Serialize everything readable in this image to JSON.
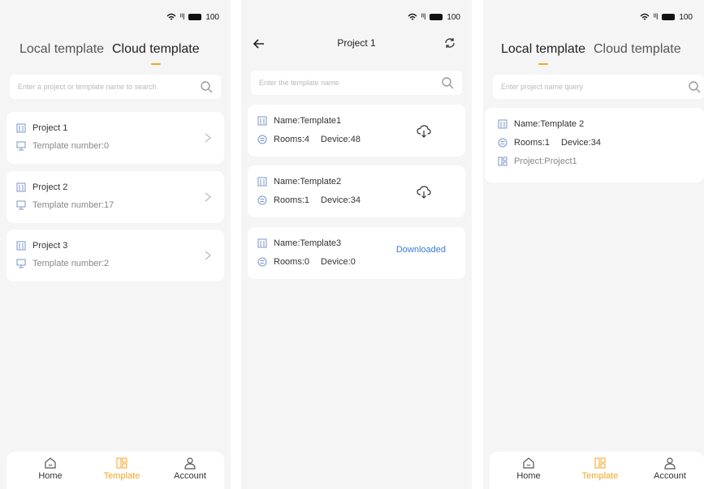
{
  "status": {
    "signal": "ᴵᴵl",
    "battery": "100"
  },
  "screen1": {
    "tabs": [
      "Local template",
      "Cloud template"
    ],
    "search_placeholder": "Enter a project or template name to search",
    "projects": [
      {
        "name": "Project 1",
        "count": "Template number:0"
      },
      {
        "name": "Project 2",
        "count": "Template number:17"
      },
      {
        "name": "Project 3",
        "count": "Template number:2"
      }
    ]
  },
  "screen2": {
    "title": "Project 1",
    "search_placeholder": "Enter the template name",
    "templates": [
      {
        "name": "Name:Template1",
        "rooms": "Rooms:4",
        "device": "Device:48",
        "state": "cloud"
      },
      {
        "name": "Name:Template2",
        "rooms": "Rooms:1",
        "device": "Device:34",
        "state": "cloud"
      },
      {
        "name": "Name:Template3",
        "rooms": "Rooms:0",
        "device": "Device:0",
        "state": "Downloaded"
      }
    ]
  },
  "screen3": {
    "tabs": [
      "Local template",
      "Cloud template"
    ],
    "search_placeholder": "Enter project name query",
    "template": {
      "name": "Name:Template 2",
      "rooms": "Rooms:1",
      "device": "Device:34",
      "project": "Project:Project1"
    }
  },
  "nav": [
    "Home",
    "Template",
    "Account"
  ],
  "colors": {
    "accent": "#f5a623",
    "link": "#3a7bd5",
    "icon": "#7b95c9"
  }
}
